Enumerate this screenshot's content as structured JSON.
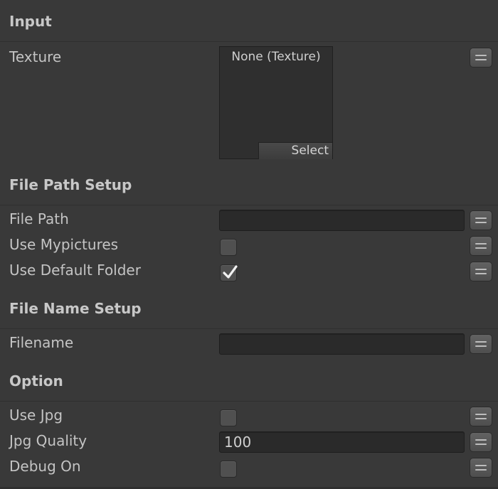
{
  "sections": {
    "input": "Input",
    "file_path_setup": "File Path Setup",
    "file_name_setup": "File Name Setup",
    "option": "Option"
  },
  "fields": {
    "texture": {
      "label": "Texture",
      "value": "None (Texture)",
      "select_label": "Select"
    },
    "file_path": {
      "label": "File Path",
      "value": ""
    },
    "use_mypictures": {
      "label": "Use Mypictures",
      "checked": false
    },
    "use_default_folder": {
      "label": "Use Default Folder",
      "checked": true
    },
    "filename": {
      "label": "Filename",
      "value": ""
    },
    "use_jpg": {
      "label": "Use Jpg",
      "checked": false
    },
    "jpg_quality": {
      "label": "Jpg Quality",
      "value": "100"
    },
    "debug_on": {
      "label": "Debug On",
      "checked": false
    }
  },
  "icons": {
    "menu": "hamburger-menu-icon",
    "check": "checkmark-icon"
  },
  "colors": {
    "background": "#393939",
    "field": "#2a2a2a",
    "text": "#c4c4c4"
  }
}
